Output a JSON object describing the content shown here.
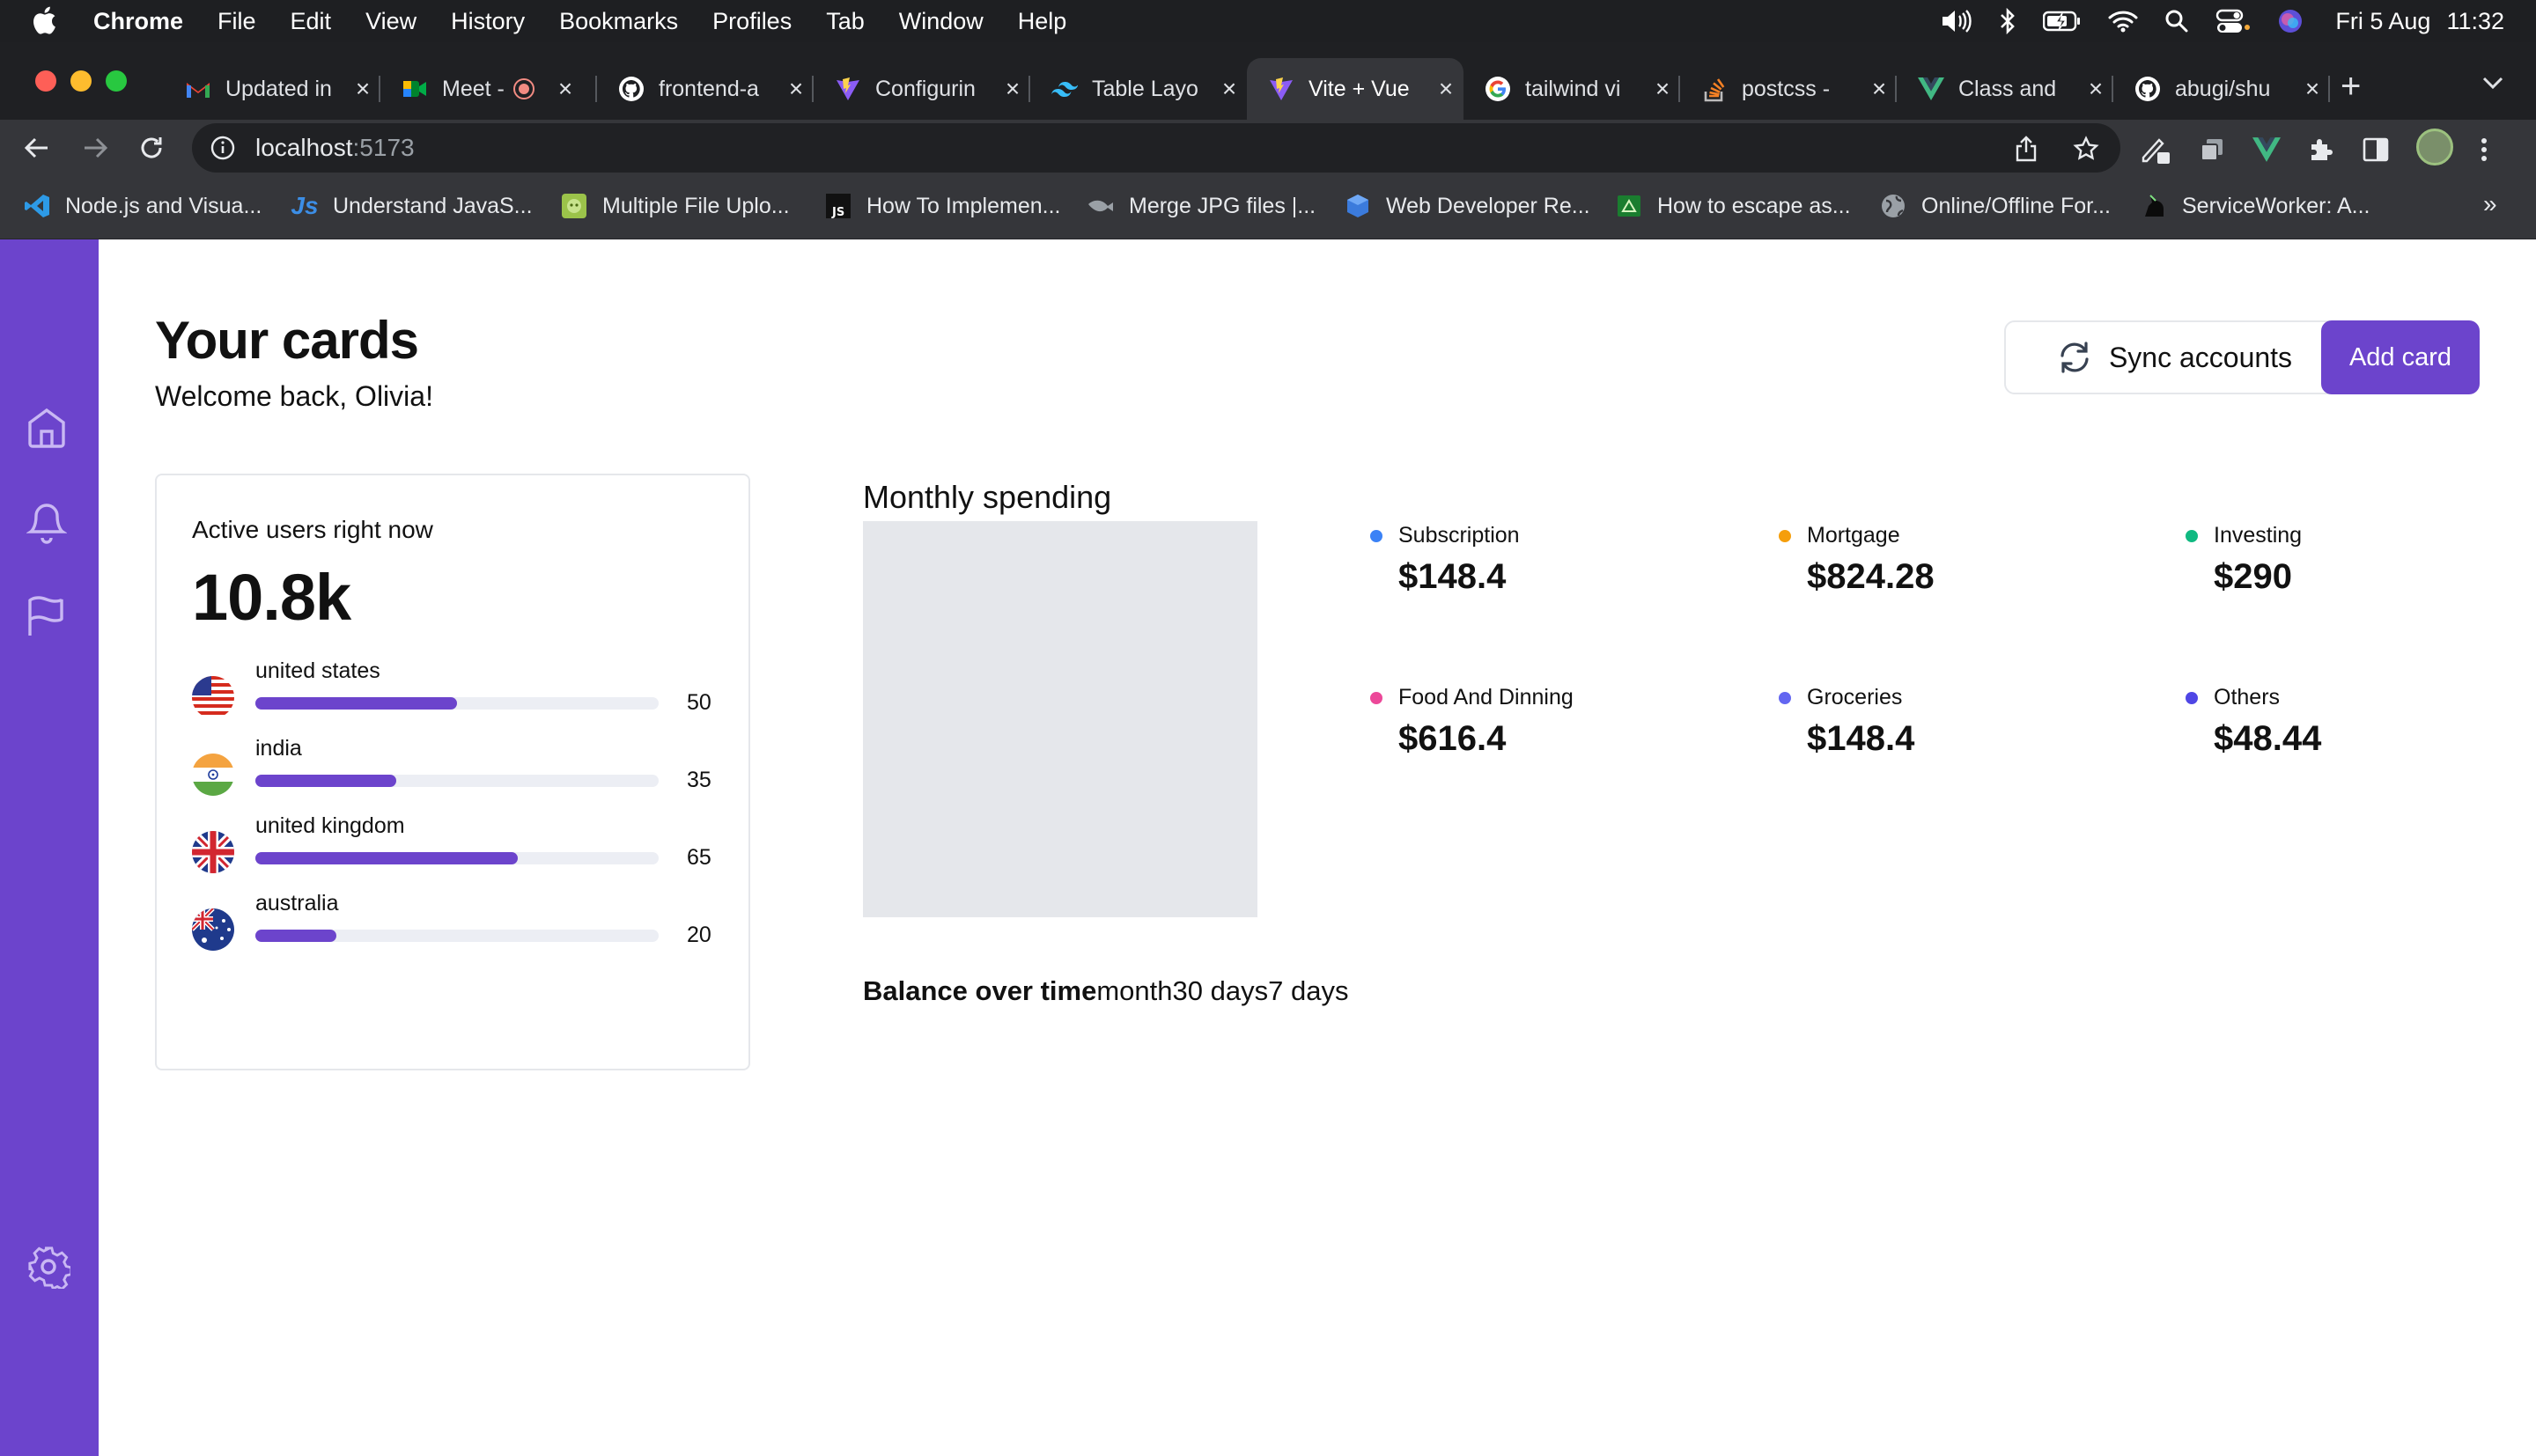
{
  "menubar": {
    "app": "Chrome",
    "items": [
      "File",
      "Edit",
      "View",
      "History",
      "Bookmarks",
      "Profiles",
      "Tab",
      "Window",
      "Help"
    ],
    "date": "Fri 5 Aug",
    "time": "11:32"
  },
  "tabs": [
    {
      "title": "Updated in",
      "icon": "gmail-icon"
    },
    {
      "title": "Meet -",
      "icon": "meet-icon"
    },
    {
      "title": "frontend-a",
      "icon": "github-icon"
    },
    {
      "title": "Configurin",
      "icon": "vite-icon"
    },
    {
      "title": "Table Layo",
      "icon": "tailwind-icon"
    },
    {
      "title": "Vite + Vue",
      "icon": "vite-icon",
      "active": true
    },
    {
      "title": "tailwind vi",
      "icon": "google-icon"
    },
    {
      "title": "postcss -",
      "icon": "stackoverflow-icon"
    },
    {
      "title": "Class and",
      "icon": "vue-icon"
    },
    {
      "title": "abugi/shu",
      "icon": "github-icon"
    }
  ],
  "address": {
    "host": "localhost",
    "port": ":5173"
  },
  "bookmarks": [
    {
      "label": "Node.js and Visua...",
      "icon": "vscode-icon"
    },
    {
      "label": "Understand JavaS...",
      "icon": "js-icon"
    },
    {
      "label": "Multiple File Uplo...",
      "icon": "android-icon"
    },
    {
      "label": "How To Implemen...",
      "icon": "js-square-icon"
    },
    {
      "label": "Merge JPG files |...",
      "icon": "fish-icon"
    },
    {
      "label": "Web Developer Re...",
      "icon": "cube-icon"
    },
    {
      "label": "How to escape as...",
      "icon": "android-square-icon"
    },
    {
      "label": "Online/Offline For...",
      "icon": "globe-icon"
    },
    {
      "label": "ServiceWorker: A...",
      "icon": "unicorn-icon"
    }
  ],
  "page": {
    "title": "Your cards",
    "welcome": "Welcome back, Olivia!",
    "sync_label": "Sync accounts",
    "add_label": "Add card"
  },
  "active_users": {
    "label": "Active users right now",
    "value": "10.8k",
    "countries": [
      {
        "name": "united states",
        "value": 50,
        "display": "50"
      },
      {
        "name": "india",
        "value": 35,
        "display": "35"
      },
      {
        "name": "united kingdom",
        "value": 65,
        "display": "65"
      },
      {
        "name": "australia",
        "value": 20,
        "display": "20"
      }
    ]
  },
  "spending": {
    "title": "Monthly spending",
    "items": [
      {
        "label": "Subscription",
        "value": "$148.4",
        "color": "#3b82f6"
      },
      {
        "label": "Mortgage",
        "value": "$824.28",
        "color": "#f59e0b"
      },
      {
        "label": "Investing",
        "value": "$290",
        "color": "#10b981"
      },
      {
        "label": "Food And Dinning",
        "value": "$616.4",
        "color": "#ec4899"
      },
      {
        "label": "Groceries",
        "value": "$148.4",
        "color": "#6366f1"
      },
      {
        "label": "Others",
        "value": "$48.44",
        "color": "#4f46e5"
      }
    ]
  },
  "balance": {
    "title": "Balance over time",
    "options": [
      "month",
      "30 days",
      "7 days"
    ]
  },
  "colors": {
    "accent": "#6c44cc"
  }
}
